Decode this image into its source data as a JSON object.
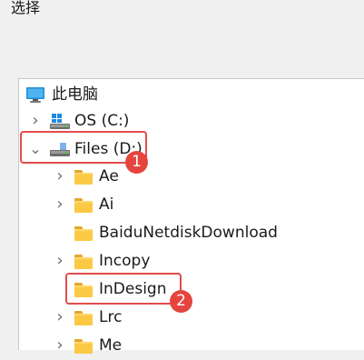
{
  "dialog": {
    "title": "选择"
  },
  "tree": {
    "root": {
      "label": "此电脑",
      "icon": "computer-icon"
    },
    "items": [
      {
        "label": "OS (C:)",
        "icon": "drive-icon",
        "expander": "›"
      },
      {
        "label": "Files (D:)",
        "icon": "drive-icon",
        "expander": "⌄"
      },
      {
        "label": "Ae",
        "icon": "folder-icon",
        "expander": "›"
      },
      {
        "label": "Ai",
        "icon": "folder-icon",
        "expander": "›"
      },
      {
        "label": "BaiduNetdiskDownload",
        "icon": "folder-icon",
        "expander": ""
      },
      {
        "label": "Incopy",
        "icon": "folder-icon",
        "expander": "›"
      },
      {
        "label": "InDesign",
        "icon": "folder-icon",
        "expander": ""
      },
      {
        "label": "Lrc",
        "icon": "folder-icon",
        "expander": "›"
      },
      {
        "label": "Me",
        "icon": "folder-icon",
        "expander": "›"
      }
    ]
  },
  "annotations": {
    "step1": "1",
    "step2": "2",
    "color": "#e34b4b"
  }
}
